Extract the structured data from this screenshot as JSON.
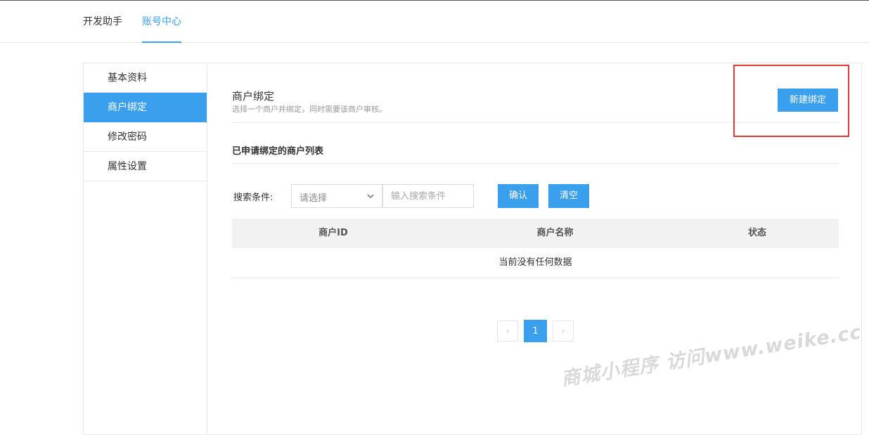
{
  "topnav": {
    "tabs": [
      {
        "label": "开发助手"
      },
      {
        "label": "账号中心"
      }
    ]
  },
  "sidebar": {
    "items": [
      {
        "label": "基本资料"
      },
      {
        "label": "商户绑定"
      },
      {
        "label": "修改密码"
      },
      {
        "label": "属性设置"
      }
    ]
  },
  "section": {
    "title": "商户绑定",
    "desc": "选择一个商户并绑定，同时需要该商户审核。",
    "new_button": "新建绑定"
  },
  "list": {
    "title": "已申请绑定的商户列表"
  },
  "search": {
    "label": "搜索条件:",
    "select_placeholder": "请选择",
    "input_placeholder": "输入搜索条件",
    "confirm_label": "确认",
    "clear_label": "清空"
  },
  "table": {
    "columns": [
      "商户ID",
      "商户名称",
      "状态"
    ],
    "empty_text": "当前没有任何数据"
  },
  "pager": {
    "prev": "‹",
    "current": "1",
    "next": "›"
  },
  "watermark": "商城小程序 访问www.weike.cc",
  "colors": {
    "accent": "#3aa0ee",
    "highlight": "#e53935"
  }
}
